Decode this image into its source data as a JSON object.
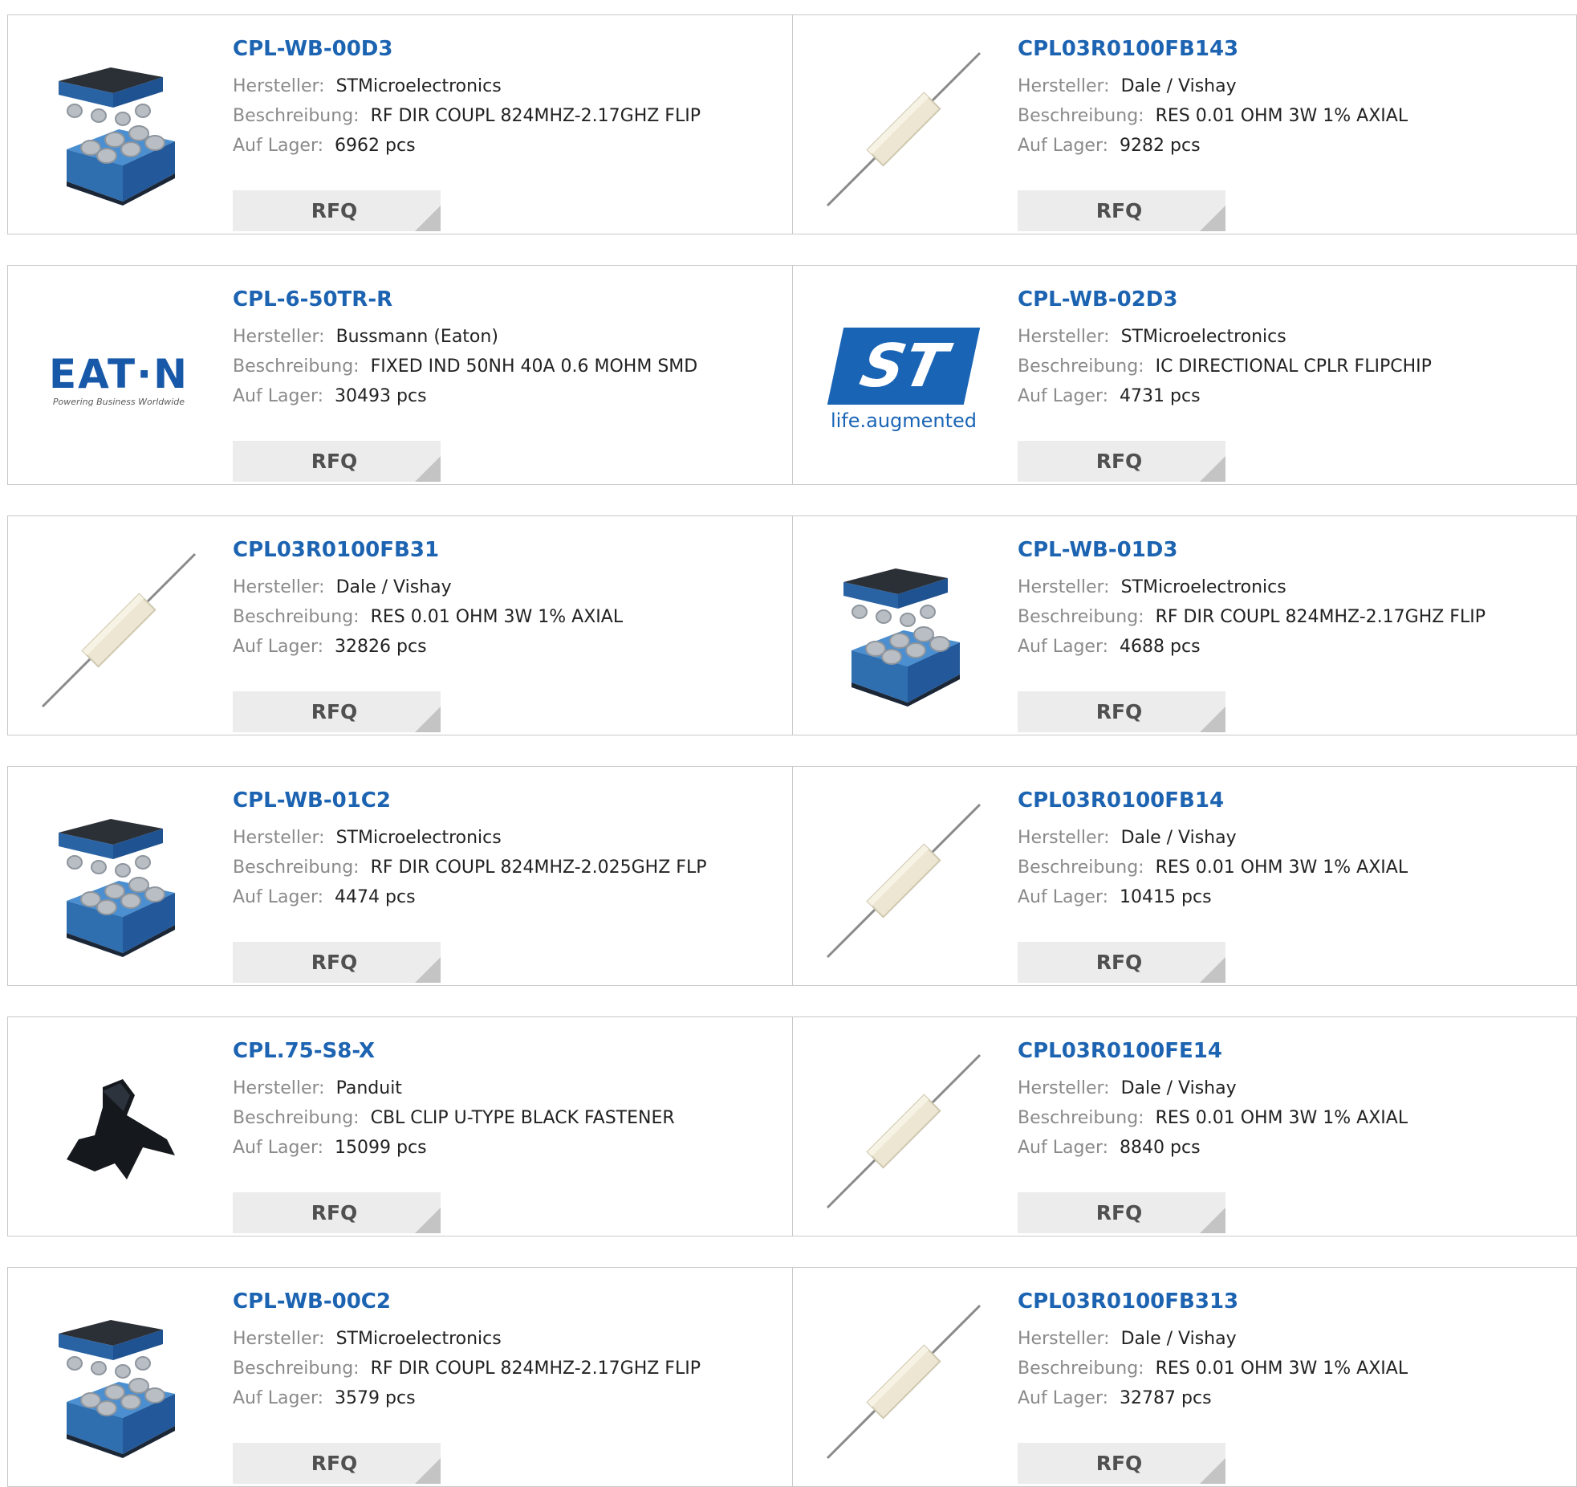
{
  "labels": {
    "manufacturer": "Hersteller:",
    "description": "Beschreibung:",
    "stock": "Auf Lager:",
    "rfq": "RFQ"
  },
  "products": [
    {
      "part": "CPL-WB-00D3",
      "manufacturer": "STMicroelectronics",
      "description": "RF DIR COUPL 824MHZ-2.17GHZ FLIP",
      "stock": "6962 pcs",
      "image": "chip-package-icon"
    },
    {
      "part": "CPL03R0100FB143",
      "manufacturer": "Dale / Vishay",
      "description": "RES 0.01 OHM 3W 1% AXIAL",
      "stock": "9282 pcs",
      "image": "axial-resistor-icon"
    },
    {
      "part": "CPL-6-50TR-R",
      "manufacturer": "Bussmann (Eaton)",
      "description": "FIXED IND 50NH 40A 0.6 MOHM SMD",
      "stock": "30493 pcs",
      "image": "eaton-logo",
      "logo_text": "EAT·N",
      "logo_tagline": "Powering Business Worldwide"
    },
    {
      "part": "CPL-WB-02D3",
      "manufacturer": "STMicroelectronics",
      "description": "IC DIRECTIONAL CPLR FLIPCHIP",
      "stock": "4731 pcs",
      "image": "st-logo",
      "logo_text": "ST",
      "logo_tagline": "life.augmented"
    },
    {
      "part": "CPL03R0100FB31",
      "manufacturer": "Dale / Vishay",
      "description": "RES 0.01 OHM 3W 1% AXIAL",
      "stock": "32826 pcs",
      "image": "axial-resistor-icon"
    },
    {
      "part": "CPL-WB-01D3",
      "manufacturer": "STMicroelectronics",
      "description": "RF DIR COUPL 824MHZ-2.17GHZ FLIP",
      "stock": "4688 pcs",
      "image": "chip-package-icon"
    },
    {
      "part": "CPL-WB-01C2",
      "manufacturer": "STMicroelectronics",
      "description": "RF DIR COUPL 824MHZ-2.025GHZ FLP",
      "stock": "4474 pcs",
      "image": "chip-package-icon"
    },
    {
      "part": "CPL03R0100FB14",
      "manufacturer": "Dale / Vishay",
      "description": "RES 0.01 OHM 3W 1% AXIAL",
      "stock": "10415 pcs",
      "image": "axial-resistor-icon"
    },
    {
      "part": "CPL.75-S8-X",
      "manufacturer": "Panduit",
      "description": "CBL CLIP U-TYPE BLACK FASTENER",
      "stock": "15099 pcs",
      "image": "cable-clip-icon"
    },
    {
      "part": "CPL03R0100FE14",
      "manufacturer": "Dale / Vishay",
      "description": "RES 0.01 OHM 3W 1% AXIAL",
      "stock": "8840 pcs",
      "image": "axial-resistor-icon"
    },
    {
      "part": "CPL-WB-00C2",
      "manufacturer": "STMicroelectronics",
      "description": "RF DIR COUPL 824MHZ-2.17GHZ FLIP",
      "stock": "3579 pcs",
      "image": "chip-package-icon"
    },
    {
      "part": "CPL03R0100FB313",
      "manufacturer": "Dale / Vishay",
      "description": "RES 0.01 OHM 3W 1% AXIAL",
      "stock": "32787 pcs",
      "image": "axial-resistor-icon"
    }
  ],
  "colors": {
    "link": "#1c63b1",
    "label": "#8a8a8a",
    "value": "#222222",
    "button_bg": "#ececec",
    "border": "#c9c9c9"
  }
}
